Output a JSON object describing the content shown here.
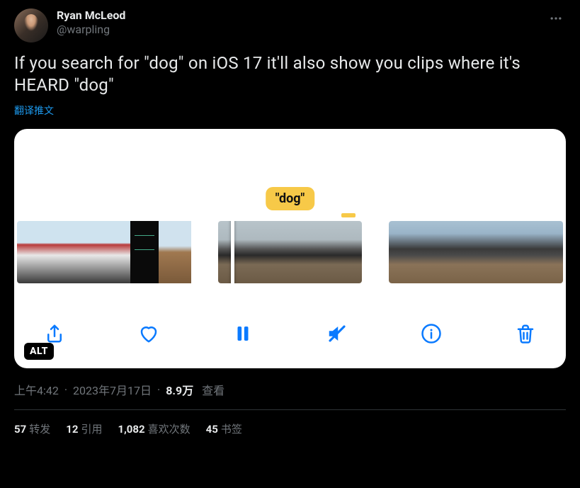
{
  "author": {
    "display_name": "Ryan McLeod",
    "handle": "@warpling"
  },
  "tweet_text": "If you search for \"dog\" on iOS 17 it'll also show you clips where it's HEARD \"dog\"",
  "translate_label": "翻译推文",
  "media": {
    "tag": "\"dog\"",
    "alt_badge": "ALT"
  },
  "meta": {
    "time": "上午4:42",
    "date": "2023年7月17日",
    "views_number": "8.9万",
    "views_label": "查看"
  },
  "stats": {
    "retweets": {
      "count": "57",
      "label": "转发"
    },
    "quotes": {
      "count": "12",
      "label": "引用"
    },
    "likes": {
      "count": "1,082",
      "label": "喜欢次数"
    },
    "bookmarks": {
      "count": "45",
      "label": "书签"
    }
  },
  "icons": {
    "share": "share-icon",
    "heart": "heart-icon",
    "pause": "pause-icon",
    "mute": "mute-icon",
    "info": "info-icon",
    "trash": "trash-icon",
    "more": "more-icon"
  }
}
